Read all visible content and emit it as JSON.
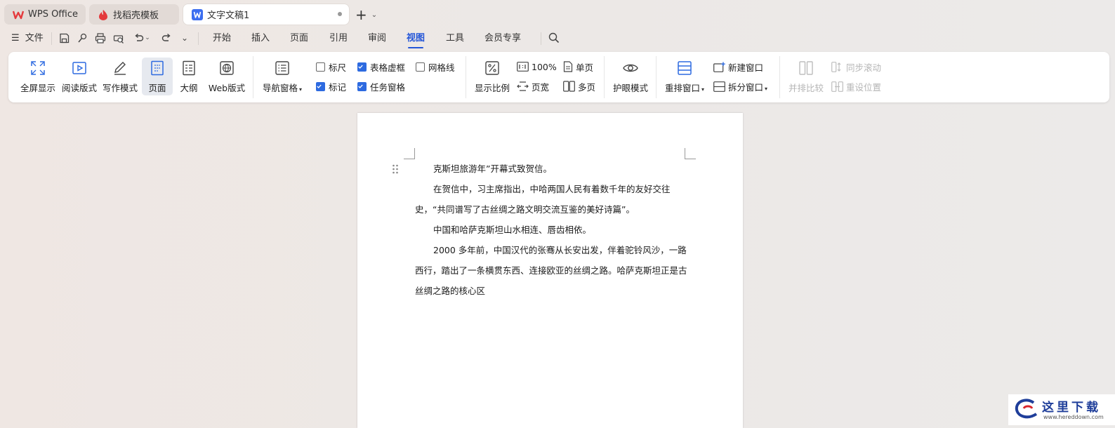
{
  "tabs": [
    {
      "label": "WPS Office",
      "icon": "wps-logo-icon",
      "state": "inactive"
    },
    {
      "label": "找稻壳模板",
      "icon": "docer-icon",
      "state": "inactive"
    },
    {
      "label": "文字文稿1",
      "icon": "word-doc-icon",
      "state": "active"
    }
  ],
  "menu": {
    "file_label": "文件",
    "items": [
      "开始",
      "插入",
      "页面",
      "引用",
      "审阅",
      "视图",
      "工具",
      "会员专享"
    ],
    "selected": "视图"
  },
  "ribbon": {
    "fullscreen": "全屏显示",
    "reading": "阅读版式",
    "writing": "写作模式",
    "page": "页面",
    "outline": "大纲",
    "web": "Web版式",
    "nav_pane": "导航窗格",
    "ruler": {
      "label": "标尺",
      "checked": false
    },
    "table_grid": {
      "label": "表格虚框",
      "checked": true
    },
    "gridlines": {
      "label": "网格线",
      "checked": false
    },
    "marks": {
      "label": "标记",
      "checked": true
    },
    "task_pane": {
      "label": "任务窗格",
      "checked": true
    },
    "zoom": "显示比例",
    "zoom_100": "100%",
    "page_width": "页宽",
    "single_page": "单页",
    "multi_page": "多页",
    "eye_care": "护眼模式",
    "arrange": "重排窗口",
    "new_window": "新建窗口",
    "split": "拆分窗口",
    "side_by_side": "并排比较",
    "sync_scroll": "同步滚动",
    "reset_pos": "重设位置"
  },
  "document": {
    "paragraphs": [
      "克斯坦旅游年”开幕式致贺信。",
      "在贺信中，习主席指出，中哈两国人民有着数千年的友好交往史，“共同谱写了古丝绸之路文明交流互鉴的美好诗篇”。",
      "中国和哈萨克斯坦山水相连、唇齿相依。",
      "2000 多年前，中国汉代的张骞从长安出发，伴着驼铃风沙，一路西行，踏出了一条横贯东西、连接欧亚的丝绸之路。哈萨克斯坦正是古丝绸之路的核心区"
    ]
  },
  "watermark": {
    "text": "这里下载",
    "url": "www.hereddown.com"
  },
  "colors": {
    "accent": "#2456d8",
    "checkbox": "#2d6ae0",
    "wps_red": "#e4393c",
    "doc_blue": "#3b6ef0"
  }
}
